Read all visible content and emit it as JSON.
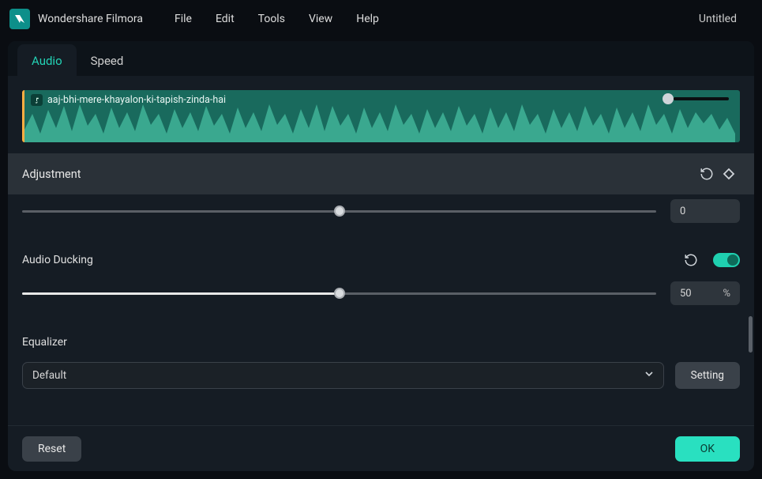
{
  "app": {
    "name": "Wondershare Filmora"
  },
  "menu": {
    "file": "File",
    "edit": "Edit",
    "tools": "Tools",
    "view": "View",
    "help": "Help"
  },
  "document": {
    "title": "Untitled"
  },
  "tabs": {
    "audio": "Audio",
    "speed": "Speed"
  },
  "clip": {
    "name": "aaj-bhi-mere-khayalon-ki-tapish-zinda-hai"
  },
  "sections": {
    "adjustment": {
      "title": "Adjustment",
      "value_display": "0",
      "slider_pct": 50
    },
    "ducking": {
      "title": "Audio Ducking",
      "value_display": "50",
      "suffix": "%",
      "slider_pct": 50,
      "enabled": true
    },
    "equalizer": {
      "title": "Equalizer",
      "selected": "Default",
      "setting_btn": "Setting"
    }
  },
  "footer": {
    "reset": "Reset",
    "ok": "OK"
  },
  "colors": {
    "accent": "#23d3b6",
    "panel": "#151c24",
    "bg": "#0a0d12"
  }
}
